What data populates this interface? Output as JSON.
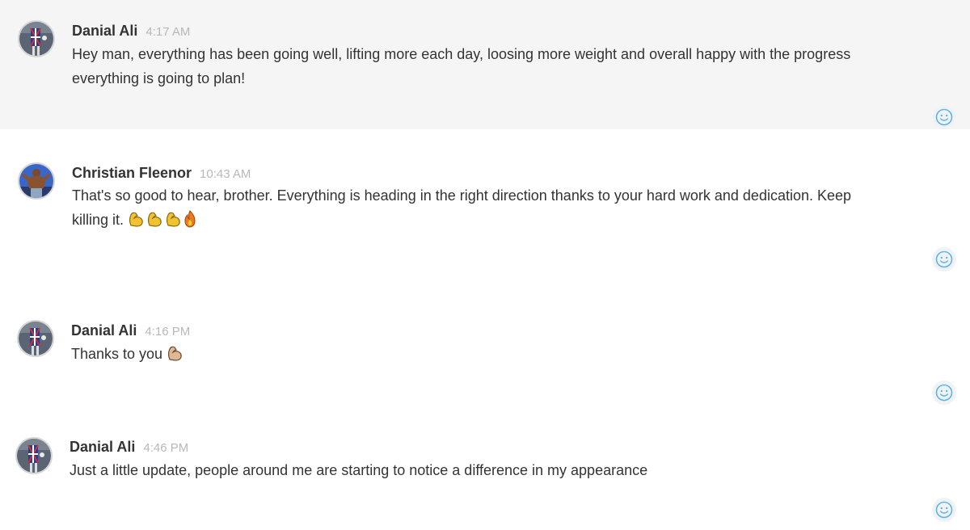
{
  "messages": [
    {
      "author": "Danial Ali",
      "time": "4:17 AM",
      "text": "Hey man, everything has been going well, lifting more each day, loosing more weight and overall happy with the progress everything is going to plan!"
    },
    {
      "author": "Christian Fleenor",
      "time": "10:43 AM",
      "text": "That's so good to hear, brother. Everything is heading in the right direction thanks to your hard work and dedication. Keep killing it.",
      "emojis": [
        "flexed-biceps",
        "flexed-biceps",
        "flexed-biceps",
        "fire"
      ]
    },
    {
      "author": "Danial Ali",
      "time": "4:16 PM",
      "text": "Thanks to you",
      "emojis": [
        "flexed-biceps"
      ]
    },
    {
      "author": "Danial Ali",
      "time": "4:46 PM",
      "text": "Just a little update, people around me are starting to notice a difference in my appearance"
    }
  ],
  "colors": {
    "highlight_bg": "#f5f5f5",
    "name": "#333333",
    "time": "#b8b8b8",
    "reaction_icon": "#5bb6e8"
  },
  "icons": {
    "reaction": "smiley-icon"
  }
}
